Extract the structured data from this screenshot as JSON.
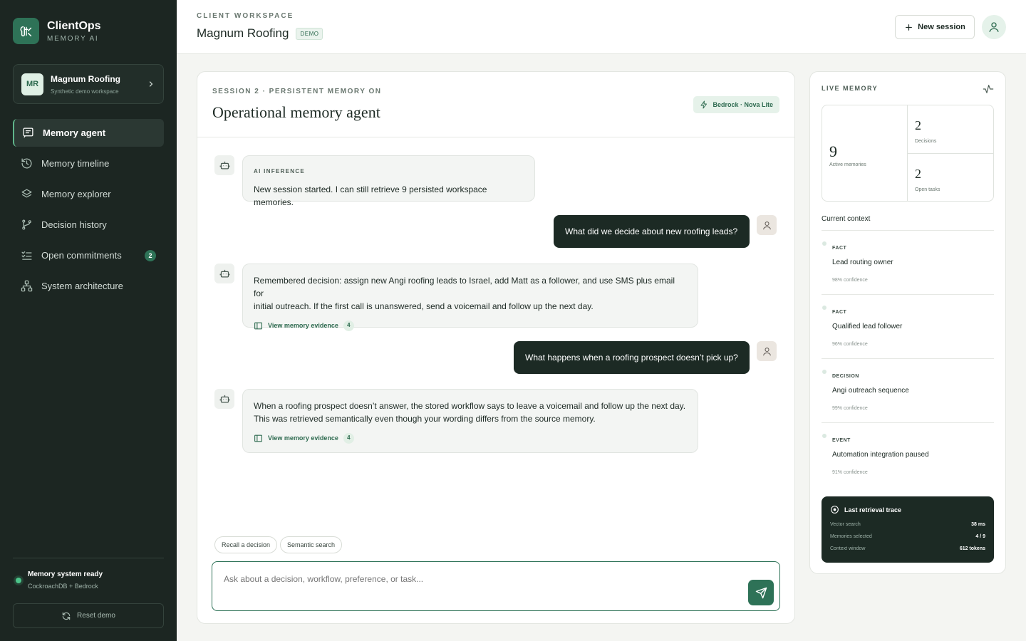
{
  "brand": {
    "name": "ClientOps",
    "subtitle": "MEMORY AI"
  },
  "workspace": {
    "initials": "MR",
    "name": "Magnum Roofing",
    "subtitle": "Synthetic demo workspace"
  },
  "nav": [
    {
      "label": "Memory agent",
      "icon": "chat-icon",
      "active": true
    },
    {
      "label": "Memory timeline",
      "icon": "history-icon"
    },
    {
      "label": "Memory explorer",
      "icon": "layers-icon"
    },
    {
      "label": "Decision history",
      "icon": "git-branch-icon"
    },
    {
      "label": "Open commitments",
      "icon": "checklist-icon",
      "badge": "2"
    },
    {
      "label": "System architecture",
      "icon": "network-icon"
    }
  ],
  "status": {
    "title": "Memory system ready",
    "subtitle": "CockroachDB + Bedrock"
  },
  "reset_label": "Reset demo",
  "header": {
    "eyebrow": "CLIENT WORKSPACE",
    "title": "Magnum Roofing",
    "badge": "DEMO",
    "new_session": "New session"
  },
  "chat": {
    "session_label": "SESSION 2 · PERSISTENT MEMORY ON",
    "title": "Operational memory agent",
    "model": "Bedrock · Nova Lite",
    "messages": [
      {
        "role": "ai",
        "tag": "AI INFERENCE",
        "text": "New session started. I can still retrieve 9 persisted workspace memories."
      },
      {
        "role": "user",
        "text": "What did we decide about new roofing leads?"
      },
      {
        "role": "ai",
        "text_line1": "Remembered decision: assign new Angi roofing leads to Israel, add Matt as a follower, and use SMS plus email for",
        "text_line2": "initial outreach. If the first call is unanswered, send a voicemail and follow up the next day.",
        "evidence_label": "View memory evidence",
        "evidence_count": "4"
      },
      {
        "role": "user",
        "text": "What happens when a roofing prospect doesn’t pick up?"
      },
      {
        "role": "ai",
        "text_line1": "When a roofing prospect doesn’t answer, the stored workflow says to leave a voicemail and follow up the next day.",
        "text_line2": "This was retrieved semantically even though your wording differs from the source memory.",
        "evidence_label": "View memory evidence",
        "evidence_count": "4"
      }
    ],
    "chips": [
      "Recall a decision",
      "Semantic search"
    ],
    "input_placeholder": "Ask about a decision, workflow, preference, or task..."
  },
  "live_memory": {
    "title": "LIVE MEMORY",
    "active": {
      "value": "9",
      "label": "Active memories"
    },
    "decisions": {
      "value": "2",
      "label": "Decisions"
    },
    "tasks": {
      "value": "2",
      "label": "Open tasks"
    },
    "context_title": "Current context",
    "context": [
      {
        "type": "FACT",
        "label": "Lead routing owner",
        "confidence": "98% confidence"
      },
      {
        "type": "FACT",
        "label": "Qualified lead follower",
        "confidence": "96% confidence"
      },
      {
        "type": "DECISION",
        "label": "Angi outreach sequence",
        "confidence": "99% confidence"
      },
      {
        "type": "EVENT",
        "label": "Automation integration paused",
        "confidence": "91% confidence"
      }
    ],
    "trace": {
      "title": "Last retrieval trace",
      "rows": [
        {
          "key": "Vector search",
          "value": "38 ms"
        },
        {
          "key": "Memories selected",
          "value": "4 / 9"
        },
        {
          "key": "Context window",
          "value": "612 tokens"
        }
      ]
    }
  }
}
